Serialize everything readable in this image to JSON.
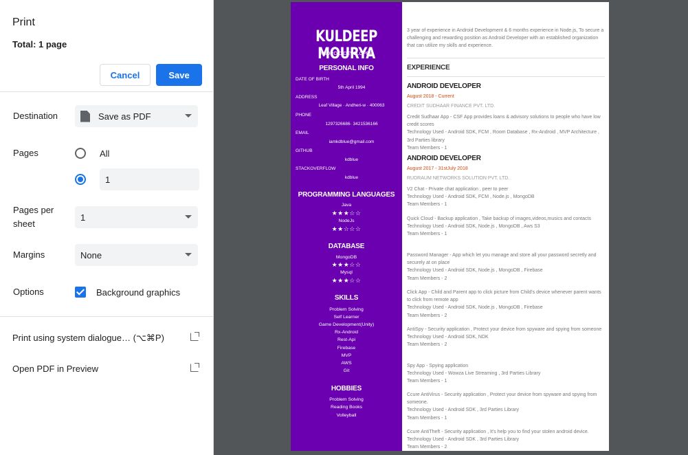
{
  "panel": {
    "title": "Print",
    "total": "Total: 1 page",
    "cancel_label": "Cancel",
    "save_label": "Save",
    "destination_label": "Destination",
    "destination_value": "Save as PDF",
    "pages_label": "Pages",
    "pages_all_label": "All",
    "pages_custom_value": "1",
    "pages_per_sheet_label_line1": "Pages per",
    "pages_per_sheet_label_line2": "sheet",
    "pages_per_sheet_value": "1",
    "margins_label": "Margins",
    "margins_value": "None",
    "options_label": "Options",
    "background_graphics_label": "Background graphics",
    "system_dialogue_label": "Print using system dialogue… (⌥⌘P)",
    "open_preview_label": "Open PDF in Preview"
  },
  "colors": {
    "accent": "#1a73e8",
    "resume_sidebar": "#6a00b0",
    "preview_bg": "#525659",
    "job_date": "#d9480f"
  },
  "resume": {
    "name": "KULDEEP MOURYA",
    "role": "ANDROID DEVELOPER",
    "personal_info_heading": "PERSONAL INFO",
    "dob_label": "DATE OF BIRTH",
    "dob_value": "5th April 1994",
    "address_label": "ADDRESS",
    "address_value": "Leaf Village · Andheri-w · 400063",
    "phone_label": "PHONE",
    "phone_value": "1297326686· 3421536166",
    "email_label": "EMAIL",
    "email_value": "iamkdblue@gmail.com",
    "github_label": "GITHUB",
    "github_value": "kdblue",
    "stackoverflow_label": "STACKOVERFLOW",
    "stackoverflow_value": "kdblue",
    "programming_heading": "PROGRAMMING LANGUAGES",
    "languages": [
      {
        "name": "Java",
        "stars": "★★★☆☆"
      },
      {
        "name": "NodeJs",
        "stars": "★★☆☆☆"
      }
    ],
    "database_heading": "DATABASE",
    "databases": [
      {
        "name": "MongoDB",
        "stars": "★★★☆☆"
      },
      {
        "name": "Mysql",
        "stars": "★★★☆☆"
      }
    ],
    "skills_heading": "SKILLS",
    "skills": [
      "Problem Solving",
      "Self Learner",
      "Game Development(Unity)",
      "Rx-Android",
      "Rest-Api",
      "Firebase",
      "MVP",
      "AWS",
      "Git"
    ],
    "hobbies_heading": "HOBBIES",
    "hobbies": [
      "Problem Solving",
      "Reading Books",
      "Volleyball"
    ],
    "summary": "3 year of experience in Android Development & 6 months experience in Node.js, To secure a challenging and rewarding position as Android Developer with an established organization that can utilize my skills and experience.",
    "experience_heading": "EXPERIENCE",
    "jobs": [
      {
        "title": "ANDROID DEVELOPER",
        "date": "August 2018 - Current",
        "company": "CREDIT SUDHAAR FINANCE PVT. LTD.",
        "projects": [
          {
            "desc": "Credit Sudhaar App - CSF App provides loans & advisory solutions to people who have low credit scores",
            "tech": "Technology Used - Android SDK, FCM , Room Database , Rx-Android , MVP Architecture , 3rd Parties library",
            "team": "Team Members - 1"
          }
        ]
      },
      {
        "title": "ANDROID DEVELOPER",
        "date": "August 2017 - 31stJuly 2018",
        "company": "RUDRAUM NETWORKS SOLUTION PVT. LTD.",
        "projects": [
          {
            "desc": "V2 Chat - Private chat application , peer to peer",
            "tech": "Technology Used - Android SDK, FCM , Node.js , MongoDB",
            "team": "Team Members - 1"
          },
          {
            "desc": "Quick Cloud - Backup application , Take backup of images,videos,musics and contacts",
            "tech": "Technology Used - Android SDK, Node.js , MongoDB , Aws S3",
            "team": "Team Members - 1"
          },
          {
            "desc": "Password Manager - App which let you manage and store all your password secretly and securely at on place",
            "tech": "Technology Used - Android SDK, Node.js , MongoDB , Firebase",
            "team": "Team Members - 2"
          },
          {
            "desc": "Click App - Child and Parent app to click picture from Child's device whenever parent wants to click from remote app",
            "tech": "Technology Used - Android SDK, Node.js , MongoDB , Firebase",
            "team": "Team Members - 2"
          },
          {
            "desc": "AntiSpy - Security application , Protect your device from spyware and spying from someone",
            "tech": "Technology Used - Android SDK, NDK",
            "team": "Team Members - 2"
          },
          {
            "desc": "Spy App - Spying application",
            "tech": "Technology Used - Wowza Live Streaming , 3rd Parties Library",
            "team": "Team Members - 1"
          },
          {
            "desc": "Ccure AntiVirus - Security application , Protect your device from spyware and spying from someone.",
            "tech": "Technology Used - Android SDK , 3rd Parties Library",
            "team": "Team Members - 1"
          },
          {
            "desc": "Ccure AntiTheft - Security application , It's help you to find your stolen android device.",
            "tech": "Technology Used - Android SDK , 3rd Parties Library",
            "team": "Team Members - 2"
          }
        ]
      }
    ]
  }
}
